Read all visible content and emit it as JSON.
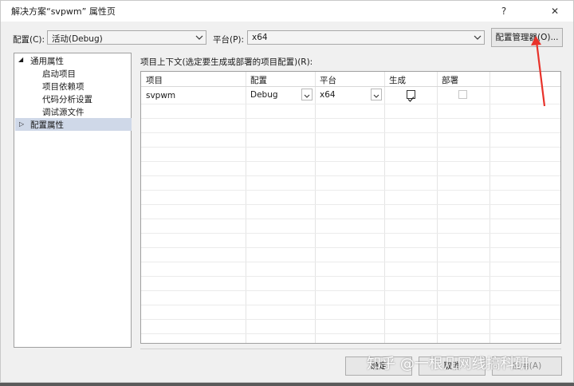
{
  "window": {
    "title": "解决方案“svpwm” 属性页",
    "help_button": "?",
    "close_button": "✕"
  },
  "toolbar": {
    "config_label": "配置(C):",
    "config_value": "活动(Debug)",
    "platform_label": "平台(P):",
    "platform_value": "x64",
    "config_manager_button": "配置管理器(O)..."
  },
  "tree": {
    "items": [
      {
        "label": "通用属性",
        "expander": "◢",
        "level": 0
      },
      {
        "label": "启动项目",
        "level": 1
      },
      {
        "label": "项目依赖项",
        "level": 1
      },
      {
        "label": "代码分析设置",
        "level": 1
      },
      {
        "label": "调试源文件",
        "level": 1
      },
      {
        "label": "配置属性",
        "expander": "▷",
        "level": 0,
        "selected": true
      }
    ]
  },
  "main": {
    "context_label": "项目上下文(选定要生成或部署的项目配置)(R):",
    "columns": [
      "项目",
      "配置",
      "平台",
      "生成",
      "部署"
    ],
    "rows": [
      {
        "project": "svpwm",
        "config": "Debug",
        "platform": "x64",
        "build": true,
        "deploy": false
      }
    ]
  },
  "footer": {
    "ok_button": "确定",
    "cancel_button": "取消",
    "apply_button": "应用(A)"
  },
  "watermark": "知乎 @一根几网线搞科研",
  "colors": {
    "annotation_arrow": "#e8322a",
    "selection": "#cfd8e8"
  }
}
